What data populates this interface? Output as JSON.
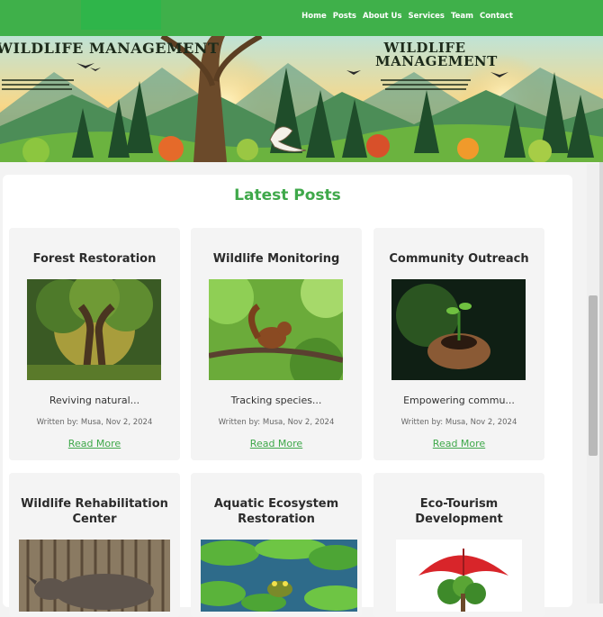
{
  "nav": {
    "items": [
      "Home",
      "Posts",
      "About Us",
      "Services",
      "Team",
      "Contact"
    ]
  },
  "hero": {
    "title_left": "WILDLIFE MANAGEMENT",
    "title_right": "WILDLIFE MANAGEMENT"
  },
  "section": {
    "title": "Latest Posts"
  },
  "posts": [
    {
      "title": "Forest Restoration",
      "excerpt": "Reviving natural...",
      "meta": "Written by: Musa, Nov 2, 2024",
      "link": "Read More"
    },
    {
      "title": "Wildlife Monitoring",
      "excerpt": "Tracking species...",
      "meta": "Written by: Musa, Nov 2, 2024",
      "link": "Read More"
    },
    {
      "title": "Community Outreach",
      "excerpt": "Empowering commu...",
      "meta": "Written by: Musa, Nov 2, 2024",
      "link": "Read More"
    },
    {
      "title": "Wildlife Rehabilitation Center"
    },
    {
      "title": "Aquatic Ecosystem Restoration"
    },
    {
      "title": "Eco-Tourism Development"
    }
  ],
  "colors": {
    "brand_green": "#3fb04a",
    "accent_green": "#3fa84a"
  }
}
